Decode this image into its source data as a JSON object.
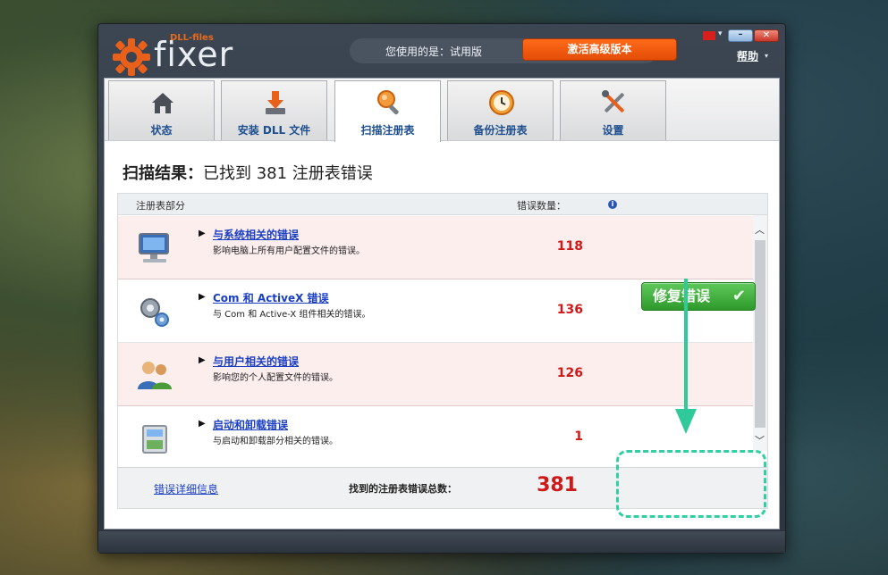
{
  "app": {
    "brand_small": "DLL-files",
    "brand": "fixer",
    "license_label": "您使用的是：试用版",
    "activate_label": "激活高级版本",
    "help_label": "帮助"
  },
  "tabs": [
    {
      "label": "状态",
      "icon": "home-icon"
    },
    {
      "label": "安装 DLL 文件",
      "icon": "download-icon"
    },
    {
      "label": "扫描注册表",
      "icon": "magnifier-icon",
      "active": true
    },
    {
      "label": "备份注册表",
      "icon": "clock-icon"
    },
    {
      "label": "设置",
      "icon": "tools-icon"
    }
  ],
  "results": {
    "title_prefix": "扫描结果：",
    "title_text": "已找到 381 注册表错误",
    "col_section": "注册表部分",
    "col_count": "错误数量："
  },
  "rows": [
    {
      "title": "与系统相关的错误",
      "desc": "影响电脑上所有用户配置文件的错误。",
      "count": "118",
      "icon": "monitor-icon"
    },
    {
      "title": "Com 和 ActiveX 错误",
      "desc": "与 Com 和 Active-X 组件相关的错误。",
      "count": "136",
      "icon": "gears-icon"
    },
    {
      "title": "与用户相关的错误",
      "desc": "影响您的个人配置文件的错误。",
      "count": "126",
      "icon": "users-icon"
    },
    {
      "title": "启动和卸载错误",
      "desc": "与启动和卸载部分相关的错误。",
      "count": "1",
      "icon": "install-box-icon"
    }
  ],
  "footer": {
    "details_link": "错误详细信息",
    "total_label": "找到的注册表错误总数：",
    "total_count": "381",
    "fix_button": "修复错误"
  },
  "colors": {
    "accent_orange": "#e34d06",
    "error_red": "#d01818",
    "fix_green": "#2f9a2c",
    "highlight_teal": "#30d0a3"
  }
}
